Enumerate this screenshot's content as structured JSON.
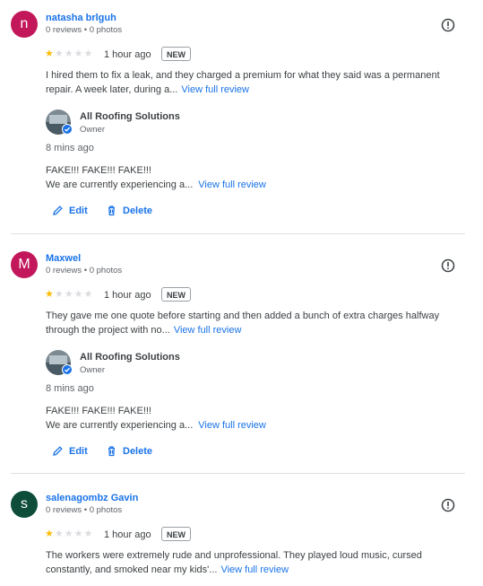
{
  "reviews": [
    {
      "reviewer_name": "natasha brlguh",
      "avatar_letter": "n",
      "avatar_color": "#c2185b",
      "meta": "0 reviews • 0 photos",
      "rating": 1,
      "time": "1 hour ago",
      "badge": "NEW",
      "text_line1": "I hired them to fix a leak, and they charged a premium for what they said was a permanent",
      "text_line2": "repair. A week later, during a...",
      "more_label": "View full review",
      "reply": {
        "owner_name": "All Roofing Solutions",
        "owner_role": "Owner",
        "time": "8 mins ago",
        "line1": "FAKE!!! FAKE!!! FAKE!!!",
        "line2": "We are currently experiencing a...",
        "more_label": "View full review"
      },
      "edit_label": "Edit",
      "delete_label": "Delete"
    },
    {
      "reviewer_name": "Maxwel",
      "avatar_letter": "M",
      "avatar_color": "#c2185b",
      "meta": "0 reviews • 0 photos",
      "rating": 1,
      "time": "1 hour ago",
      "badge": "NEW",
      "text_line1": "They gave me one quote before starting and then added a bunch of extra charges halfway",
      "text_line2": "through the project with no...",
      "more_label": "View full review",
      "reply": {
        "owner_name": "All Roofing Solutions",
        "owner_role": "Owner",
        "time": "8 mins ago",
        "line1": "FAKE!!! FAKE!!! FAKE!!!",
        "line2": "We are currently experiencing a...",
        "more_label": "View full review"
      },
      "edit_label": "Edit",
      "delete_label": "Delete"
    },
    {
      "reviewer_name": "salenagombz Gavin",
      "avatar_letter": "s",
      "avatar_color": "#0d4d3a",
      "meta": "0 reviews • 0 photos",
      "rating": 1,
      "time": "1 hour ago",
      "badge": "NEW",
      "text_line1": "The workers were extremely rude and unprofessional. They played loud music, cursed",
      "text_line2": "constantly, and smoked near my kids'...",
      "more_label": "View full review"
    }
  ],
  "icons": {
    "flag": "report-flag-icon",
    "edit": "pencil-icon",
    "delete": "trash-icon",
    "verified": "verified-check-icon"
  },
  "colors": {
    "link": "#1a73e8",
    "star": "#fbbc04"
  }
}
